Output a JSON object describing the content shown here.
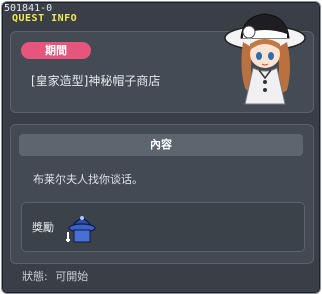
{
  "window": {
    "quest_id": "501841-0",
    "title": "QUEST INFO"
  },
  "header": {
    "period_badge": "期間",
    "quest_name": "[皇家造型]神秘帽子商店",
    "npc_icon": "npc-portrait-lady-hat"
  },
  "content": {
    "header": "內容",
    "text": "布莱尔夫人找你谈话。",
    "reward_label": "獎勵",
    "reward_icon": "blue-hat-item-icon"
  },
  "status": {
    "label": "狀態:",
    "value": "可開始"
  },
  "colors": {
    "badge": "#e6557c",
    "title": "#f2e94e",
    "panel": "#454b54"
  }
}
